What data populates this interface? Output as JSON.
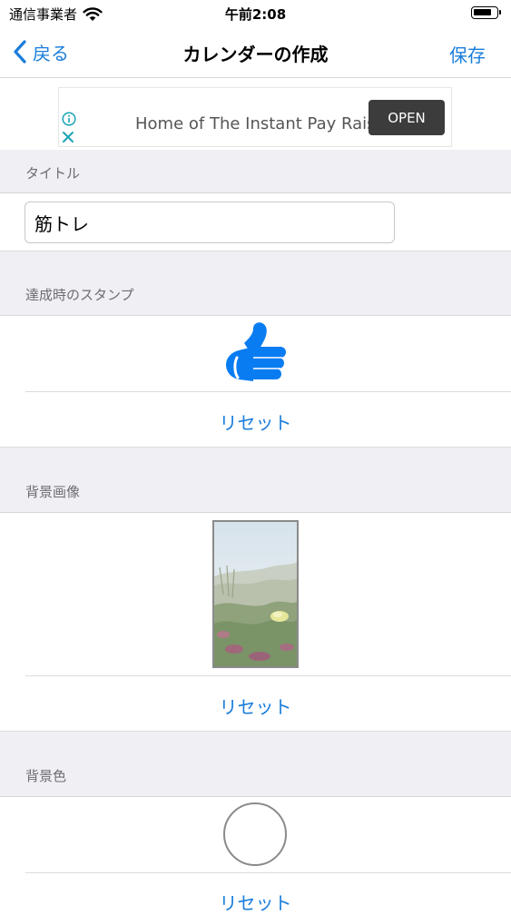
{
  "status_bar": {
    "carrier": "通信事業者",
    "time": "午前2:08"
  },
  "nav": {
    "back_label": "戻る",
    "title": "カレンダーの作成",
    "save_label": "保存"
  },
  "ad": {
    "text": "Home of The Instant Pay Raise",
    "open_label": "OPEN"
  },
  "sections": {
    "title": {
      "label": "タイトル",
      "input_value": "筋トレ"
    },
    "stamp": {
      "label": "達成時のスタンプ",
      "reset_label": "リセット"
    },
    "background_image": {
      "label": "背景画像",
      "reset_label": "リセット"
    },
    "background_color": {
      "label": "背景色",
      "reset_label": "リセット"
    }
  },
  "colors": {
    "accent": "#1a7ddb",
    "stamp": "#0a7cf2",
    "section_bg": "#efeff4"
  }
}
